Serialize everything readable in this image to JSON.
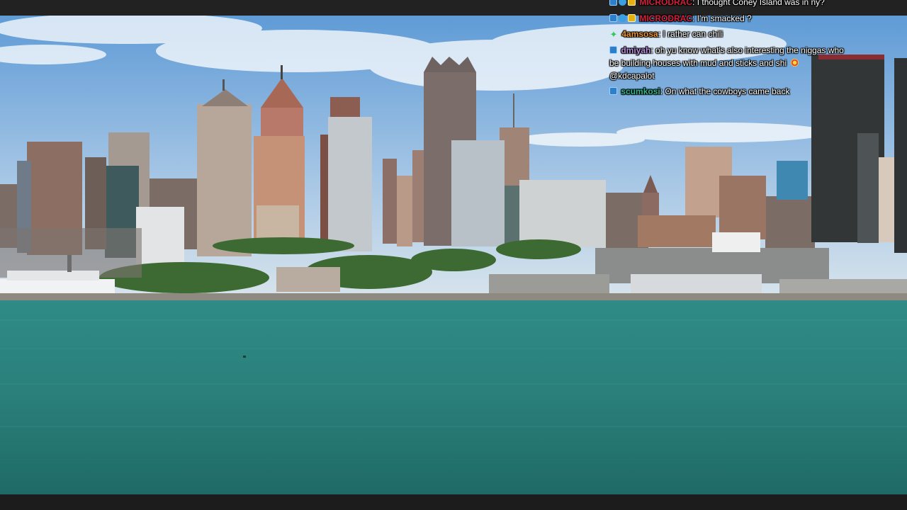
{
  "video": {
    "scene_description": "",
    "colors": {
      "sky_top": "#5f9bd6",
      "sky_bottom": "#cfe0ee",
      "water": "#2d8782",
      "water_deep": "#1f6a66",
      "letterbox": "#1c1c1c"
    }
  },
  "chat": {
    "messages": [
      {
        "badges": [
          "blue-badge-icon",
          "globe-badge-icon",
          "gold-badge-icon"
        ],
        "username": "MICRODRAC",
        "username_color": "#d81f3a",
        "separator": ":",
        "text": "I thought Coney Island was in ny?"
      },
      {
        "badges": [
          "blue-badge-icon",
          "globe-badge-icon",
          "gold-badge-icon"
        ],
        "username": "MICRODRAC",
        "username_color": "#d81f3a",
        "separator": ":",
        "text": "I'm smacked ?"
      },
      {
        "badges": [
          "green-badge-icon"
        ],
        "username": "4amsosa",
        "username_color": "#e8922b",
        "separator": ":",
        "text": "I rather can chili"
      },
      {
        "badges": [
          "blue-badge-icon"
        ],
        "username": "dmiyah",
        "username_color": "#b58ad9",
        "separator": ":",
        "text": "oh yu know what's also interesting the niggas who be building houses with mud and sticks and shi",
        "emoji": "lifebuoy-emoji-icon",
        "mention": "@kdcapalot"
      },
      {
        "badges": [
          "blue-badge-icon"
        ],
        "username": "scumkosi",
        "username_color": "#2fb88e",
        "separator": ":",
        "text": "On what the cowboys came back"
      }
    ]
  }
}
